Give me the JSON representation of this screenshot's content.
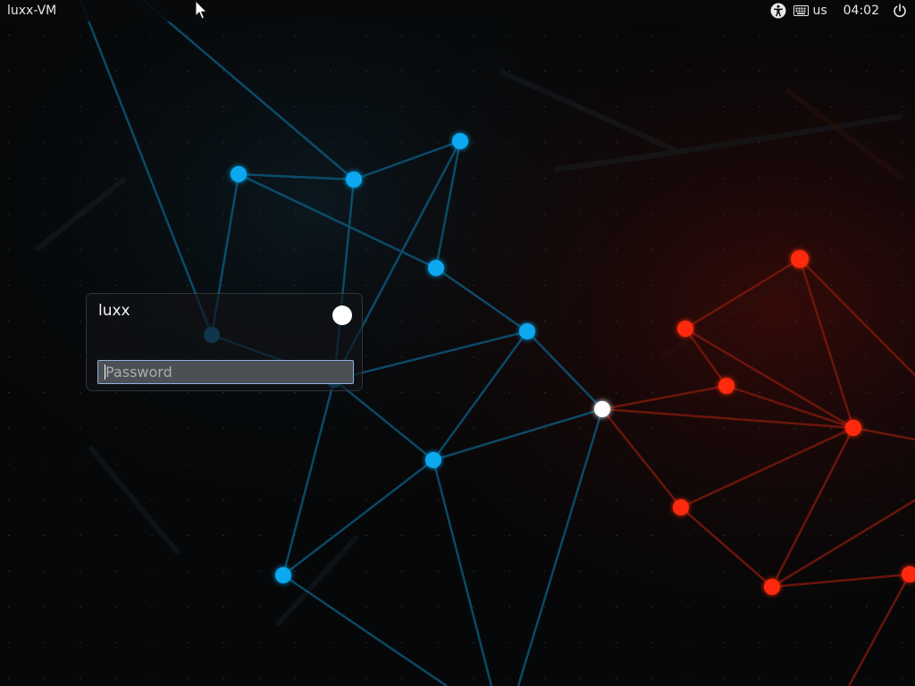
{
  "panel": {
    "hostname": "luxx-VM",
    "keyboard_layout": "us",
    "clock": "04:02",
    "icons": {
      "accessibility": "accessibility-icon",
      "keyboard": "keyboard-icon",
      "power": "power-icon"
    }
  },
  "login": {
    "username": "luxx",
    "status_indicator": "user-status-dot",
    "password_placeholder": "Password",
    "password_value": ""
  },
  "theme": {
    "blue_node": "#0aa8f0",
    "red_node": "#ff2a10",
    "white_node": "#ffffff",
    "field_border": "#8fb0e0"
  }
}
